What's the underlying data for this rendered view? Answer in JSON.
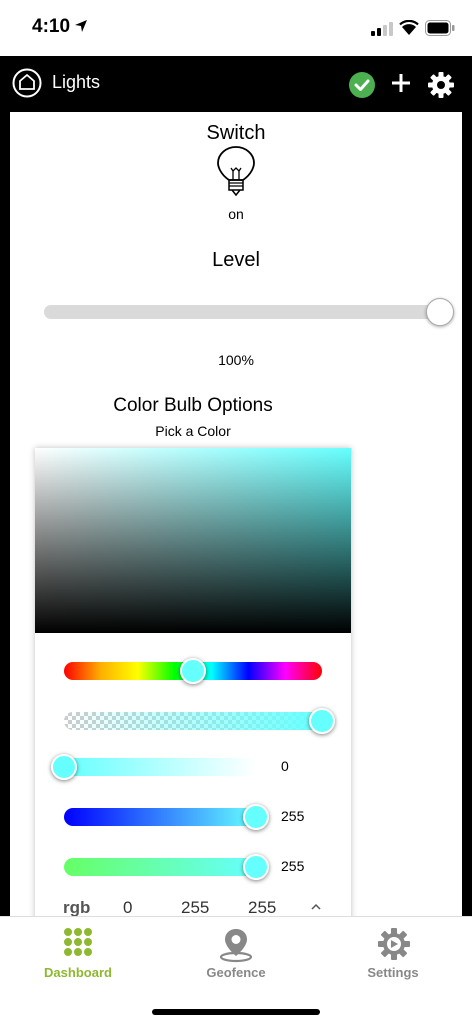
{
  "status_bar": {
    "time": "4:10"
  },
  "header": {
    "title": "Lights"
  },
  "switch": {
    "title": "Switch",
    "state": "on"
  },
  "level": {
    "title": "Level",
    "value_label": "100%",
    "value": 1.0
  },
  "color": {
    "title": "Color Bulb Options",
    "subtitle": "Pick a Color",
    "selected_hex": "#66ffff",
    "hue_fraction": 0.5,
    "alpha_fraction": 1.0,
    "red_value": "0",
    "blue_value": "255",
    "green_value": "255",
    "red_fraction": 0.0,
    "blue_fraction": 1.0,
    "green_fraction": 1.0,
    "format": {
      "label": "rgb",
      "r": "0",
      "g": "255",
      "b": "255"
    }
  },
  "tabs": [
    {
      "label": "Dashboard",
      "icon": "grid-icon",
      "color": "#8db830"
    },
    {
      "label": "Geofence",
      "icon": "location-pin-icon",
      "color": "#888888"
    },
    {
      "label": "Settings",
      "icon": "gear-icon",
      "color": "#888888"
    }
  ],
  "colors": {
    "accent_green": "#8db830",
    "check_green": "#4caf50"
  }
}
